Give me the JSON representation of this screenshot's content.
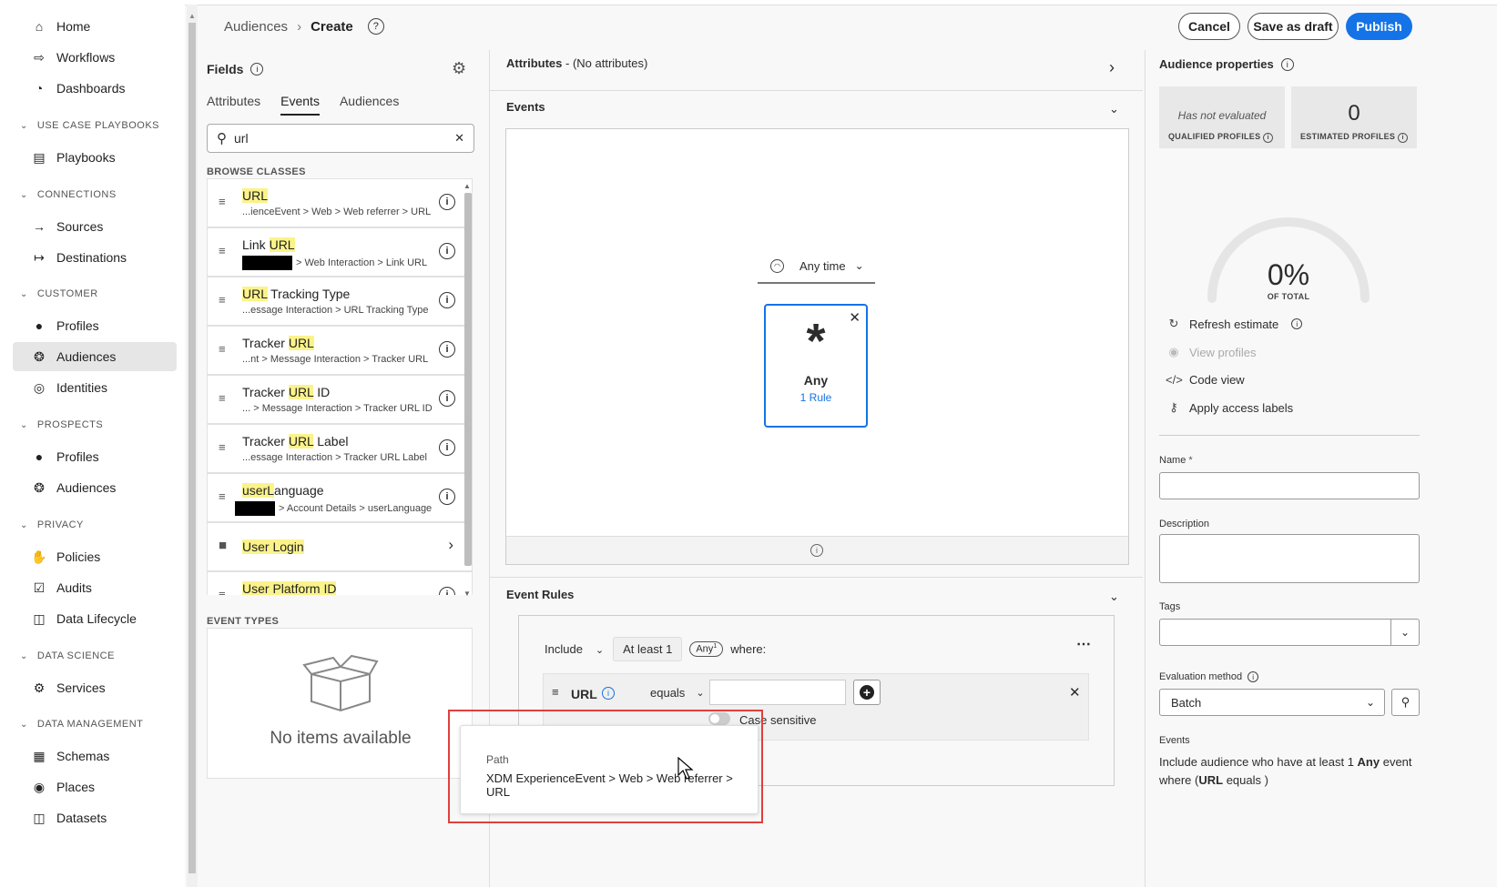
{
  "nav": {
    "home": "Home",
    "workflows": "Workflows",
    "dashboards": "Dashboards",
    "sec_playbooks": "USE CASE PLAYBOOKS",
    "playbooks": "Playbooks",
    "sec_connections": "CONNECTIONS",
    "sources": "Sources",
    "destinations": "Destinations",
    "sec_customer": "CUSTOMER",
    "customer_profiles": "Profiles",
    "customer_audiences": "Audiences",
    "identities": "Identities",
    "sec_prospects": "PROSPECTS",
    "prospect_profiles": "Profiles",
    "prospect_audiences": "Audiences",
    "sec_privacy": "PRIVACY",
    "policies": "Policies",
    "audits": "Audits",
    "data_lifecycle": "Data Lifecycle",
    "sec_data_science": "DATA SCIENCE",
    "services": "Services",
    "sec_data_management": "DATA MANAGEMENT",
    "schemas": "Schemas",
    "places": "Places",
    "datasets": "Datasets"
  },
  "header": {
    "crumb_parent": "Audiences",
    "crumb_current": "Create",
    "cancel": "Cancel",
    "save_draft": "Save as draft",
    "publish": "Publish"
  },
  "fields": {
    "title": "Fields",
    "tabs": [
      "Attributes",
      "Events",
      "Audiences"
    ],
    "search_value": "url",
    "browse_classes": "BROWSE CLASSES",
    "items": [
      {
        "pre": "",
        "hl": "URL",
        "post": "",
        "path": "...ienceEvent > Web > Web referrer > URL"
      },
      {
        "pre": "Link ",
        "hl": "URL",
        "post": "",
        "path": "> Web Interaction > Link URL"
      },
      {
        "pre": "",
        "hl": "URL",
        "post": " Tracking Type",
        "path": "...essage Interaction > URL Tracking Type"
      },
      {
        "pre": "Tracker ",
        "hl": "URL",
        "post": "",
        "path": "...nt > Message Interaction > Tracker URL"
      },
      {
        "pre": "Tracker ",
        "hl": "URL",
        "post": " ID",
        "path": "... > Message Interaction > Tracker URL ID"
      },
      {
        "pre": "Tracker ",
        "hl": "URL",
        "post": " Label",
        "path": "...essage Interaction > Tracker URL Label"
      },
      {
        "pre": "",
        "hl": "userL",
        "post": "anguage",
        "path": "> Account Details > userLanguage"
      }
    ],
    "folder": "User Login",
    "partial": "User Platform ID",
    "event_types": "EVENT TYPES",
    "empty": "No items available"
  },
  "center": {
    "attributes_label": "Attributes",
    "attributes_value": " - (No attributes)",
    "events_label": "Events",
    "time_label": "Any time",
    "card_title": "Any",
    "card_rule": "1 Rule",
    "event_rules_label": "Event Rules",
    "include": "Include",
    "at_least": "At least 1",
    "any_pill": "Any",
    "any_sup": "1",
    "where": "where:",
    "url_field": "URL",
    "operator": "equals",
    "case_sensitive": "Case sensitive"
  },
  "tooltip": {
    "label": "Path",
    "path": "XDM ExperienceEvent > Web > Web referrer > URL"
  },
  "right": {
    "title": "Audience properties",
    "has_not_evaluated": "Has not evaluated",
    "qualified_profiles": "QUALIFIED PROFILES",
    "estimated_value": "0",
    "estimated_profiles": "ESTIMATED PROFILES",
    "percent": "0%",
    "of_total": "OF TOTAL",
    "gauge_fraction": 0,
    "refresh": "Refresh estimate",
    "view_profiles": "View profiles",
    "code_view": "Code view",
    "apply_labels": "Apply access labels",
    "name_label": "Name",
    "description_label": "Description",
    "tags_label": "Tags",
    "eval_label": "Evaluation method",
    "eval_value": "Batch",
    "events_label": "Events",
    "summary_1": "Include audience who have at least 1 ",
    "summary_any": "Any",
    "summary_2": " event",
    "summary_3": "where (",
    "summary_url": "URL",
    "summary_4": " equals )"
  },
  "colors": {
    "accent": "#1473e6",
    "highlight": "#fbf38a",
    "annotation": "#e0403c"
  }
}
